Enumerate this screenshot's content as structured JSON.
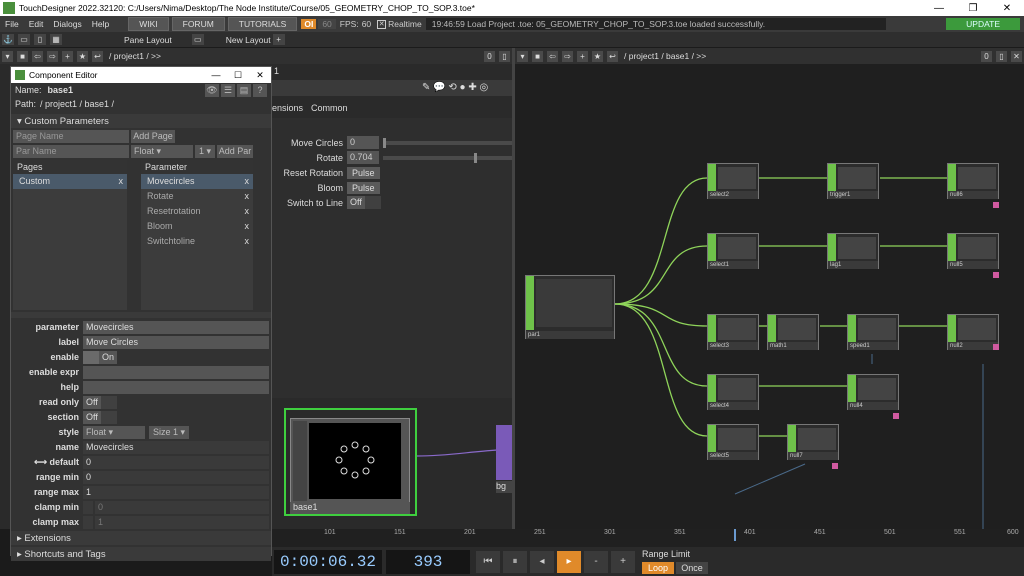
{
  "window": {
    "title": "TouchDesigner 2022.32120: C:/Users/Nima/Desktop/The Node Institute/Course/05_GEOMETRY_CHOP_TO_SOP.3.toe*"
  },
  "menu": {
    "file": "File",
    "edit": "Edit",
    "dialogs": "Dialogs",
    "help": "Help",
    "wiki": "WIKI",
    "forum": "FORUM",
    "tutorials": "TUTORIALS",
    "oi": "OI",
    "fps_box": "60",
    "fps_label": "FPS:",
    "fps": "60",
    "realtime": "Realtime",
    "status": "19:46:59 Load Project .toe: 05_GEOMETRY_CHOP_TO_SOP.3.toe loaded successfully.",
    "update": "UPDATE"
  },
  "bar2": {
    "pane_layout": "Pane Layout",
    "new_layout": "New Layout"
  },
  "left_path": "/ project1 / >>",
  "right_path": "/ project1 / base1 / >>",
  "ce": {
    "title": "Component Editor",
    "name_label": "Name:",
    "name_value": "base1",
    "path_label": "Path:",
    "path_value": "/ project1 / base1 /",
    "custom_params": "Custom Parameters",
    "page_name_ph": "Page Name",
    "add_page": "Add Page",
    "par_name_ph": "Par Name",
    "float": "Float",
    "count": "1",
    "add_par": "Add Par",
    "pages_header": "Pages",
    "pages": [
      "Custom"
    ],
    "params_header": "Parameter",
    "params": [
      "Movecircles",
      "Rotate",
      "Resetrotation",
      "Bloom",
      "Switchtoline"
    ],
    "fields": {
      "parameter_l": "parameter",
      "parameter_v": "Movecircles",
      "label_l": "label",
      "label_v": "Move Circles",
      "enable_l": "enable",
      "enable_v": "On",
      "enable_expr_l": "enable expr",
      "help_l": "help",
      "read_only_l": "read only",
      "read_only_v": "Off",
      "section_l": "section",
      "section_v": "Off",
      "style_l": "style",
      "style_v": "Float",
      "style_size": "Size 1",
      "name_l": "name",
      "name_v": "Movecircles",
      "default_l": "default",
      "default_v": "0",
      "range_min_l": "range min",
      "range_min_v": "0",
      "range_max_l": "range max",
      "range_max_v": "1",
      "clamp_min_l": "clamp min",
      "clamp_min_v": "0",
      "clamp_max_l": "clamp max",
      "clamp_max_v": "1"
    },
    "extensions": "Extensions",
    "shortcuts": "Shortcuts and Tags"
  },
  "op_tabs": {
    "extensions": "ensions",
    "common": "Common"
  },
  "op_params": {
    "move_circles": "Move Circles",
    "move_val": "0",
    "rotate": "Rotate",
    "rotate_val": "0.704",
    "rotate_frac": 0.704,
    "reset_rotation": "Reset Rotation",
    "pulse": "Pulse",
    "bloom": "Bloom",
    "switch_to_line": "Switch to Line",
    "off": "Off"
  },
  "nodes": {
    "base1": "base1",
    "bg": "bg",
    "par1": "par1",
    "select2": "select2",
    "trigger1": "trigger1",
    "null6": "null6",
    "select1": "select1",
    "lag1": "lag1",
    "null5": "null5",
    "select3": "select3",
    "math1": "math1",
    "speed1": "speed1",
    "null2": "null2",
    "select4": "select4",
    "null4": "null4",
    "select5": "select5",
    "null7": "null7"
  },
  "timeline": {
    "ticks": [
      "101",
      "151",
      "201",
      "251",
      "301",
      "351",
      "401",
      "451",
      "501",
      "551",
      "600"
    ]
  },
  "transport": {
    "timecode": "0:00:06.32",
    "frame": "393",
    "range_limit": "Range Limit",
    "loop": "Loop",
    "once": "Once"
  }
}
